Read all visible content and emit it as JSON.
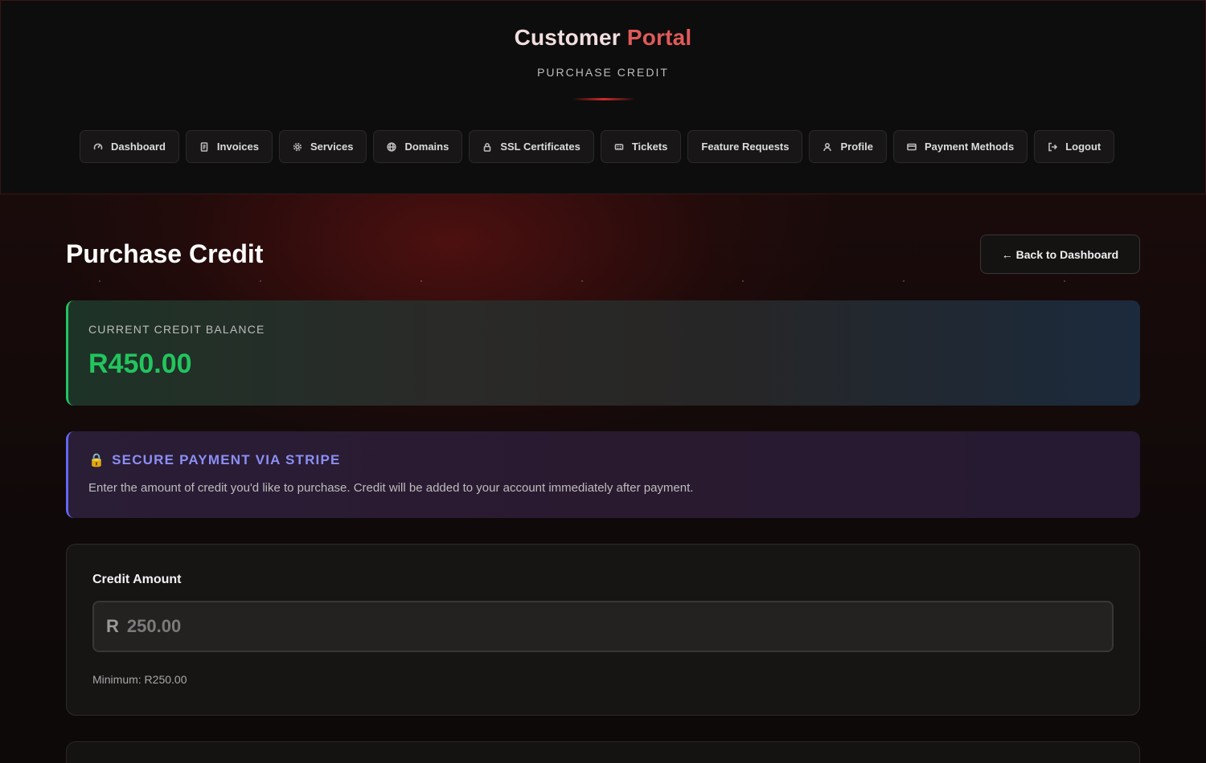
{
  "header": {
    "brand_word1": "Customer",
    "brand_word2": "Portal",
    "subtitle": "PURCHASE CREDIT"
  },
  "nav": [
    {
      "label": "Dashboard",
      "icon": "dashboard-icon"
    },
    {
      "label": "Invoices",
      "icon": "invoice-icon"
    },
    {
      "label": "Services",
      "icon": "gear-icon"
    },
    {
      "label": "Domains",
      "icon": "globe-icon"
    },
    {
      "label": "SSL Certificates",
      "icon": "lock-icon"
    },
    {
      "label": "Tickets",
      "icon": "ticket-icon"
    },
    {
      "label": "Feature Requests",
      "icon": ""
    },
    {
      "label": "Profile",
      "icon": "user-icon"
    },
    {
      "label": "Payment Methods",
      "icon": "credit-card-icon"
    },
    {
      "label": "Logout",
      "icon": "logout-icon"
    }
  ],
  "main": {
    "page_title": "Purchase Credit",
    "back_button": "← Back to Dashboard",
    "balance": {
      "label": "CURRENT CREDIT BALANCE",
      "value": "R450.00"
    },
    "stripe_notice": {
      "icon": "🔒",
      "title": "SECURE PAYMENT VIA STRIPE",
      "text": "Enter the amount of credit you'd like to purchase. Credit will be added to your account immediately after payment."
    },
    "form": {
      "label": "Credit Amount",
      "currency": "R",
      "placeholder": "250.00",
      "value": "",
      "min_note": "Minimum: R250.00"
    }
  },
  "colors": {
    "accent": "#e05a5a",
    "balance_green": "#22c55e",
    "stripe_indigo": "#6366f1"
  }
}
